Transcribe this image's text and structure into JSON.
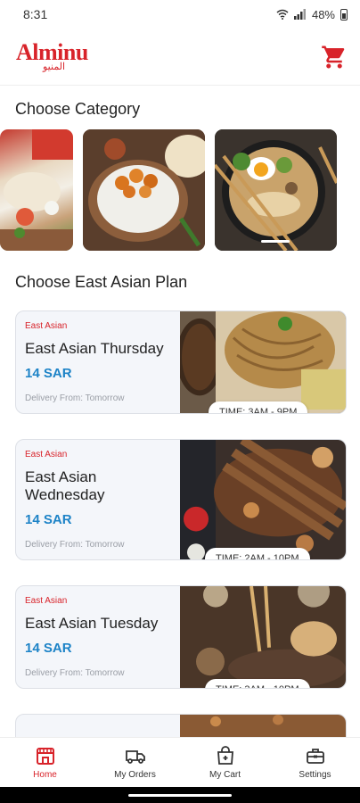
{
  "status": {
    "time": "8:31",
    "icons": [
      "wifi-icon",
      "signal-icon"
    ],
    "battery": "48%"
  },
  "appbar": {
    "logo_en": "Alminu",
    "logo_ar": "المنيو",
    "cart_icon": "cart-icon"
  },
  "sections": {
    "category_title": "Choose Category",
    "plan_title": "Choose East Asian Plan"
  },
  "plans": [
    {
      "tag": "East Asian",
      "title": "East Asian Thursday",
      "price": "14 SAR",
      "delivery": "Delivery From: Tomorrow",
      "time": "TIME: 3AM - 9PM"
    },
    {
      "tag": "East Asian",
      "title": "East Asian Wednesday",
      "price": "14 SAR",
      "delivery": "Delivery From: Tomorrow",
      "time": "TIME: 2AM - 10PM"
    },
    {
      "tag": "East Asian",
      "title": "East Asian Tuesday",
      "price": "14 SAR",
      "delivery": "Delivery From: Tomorrow",
      "time": "TIME: 3AM - 10PM"
    }
  ],
  "nav": [
    {
      "label": "Home",
      "icon": "store-icon",
      "active": true
    },
    {
      "label": "My Orders",
      "icon": "delivery-truck-icon",
      "active": false
    },
    {
      "label": "My Cart",
      "icon": "cart-bag-icon",
      "active": false
    },
    {
      "label": "Settings",
      "icon": "toolbox-icon",
      "active": false
    }
  ],
  "colors": {
    "brand": "#d8232a",
    "price": "#1d83c7"
  }
}
